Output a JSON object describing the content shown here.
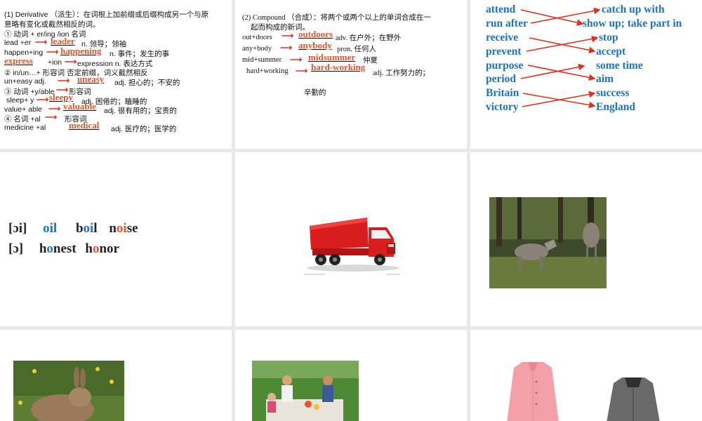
{
  "slide1": {
    "heading1": "(1) Derivative （派生）：在词根上加前缀或后缀构成另一个与原",
    "heading2": "意略有变化或截然相反的词。",
    "l1": "① 动词 + er/ing /ion      名词",
    "l2a": "lead +er",
    "ans_leader": "leader",
    "l2b": "n. 领导；领袖",
    "l3a": "happen+ing",
    "ans_happening": "happening",
    "l3b": "n. 事件；发生的事",
    "ans_express": "express",
    "l4b": "+ion",
    "l4c": "expression n. 表达方式",
    "l5": "② in/un…+ 形容词     否定前缀，词义截然相反",
    "l6a": "un+easy   adj.",
    "ans_uneasy": "uneasy",
    "l6b": "adj. 担心的；不安的",
    "l7": "③ 动词 +y/able",
    "l7b": "形容词",
    "l8a": "sleep+ y",
    "ans_sleepy": "sleepy",
    "l8b": "adj. 困倦的；瞌睡的",
    "l9a": "value+ able",
    "ans_valuable": "valuable",
    "l9b": "adj. 很有用的；宝贵的",
    "l10a": "④  名词 +al",
    "l10b": "形容词",
    "l11a": "medicine +al",
    "ans_medical": "medical",
    "l11b": "adj. 医疗的；医学的"
  },
  "slide2": {
    "heading1": "(2) Compound （合成）：将两个或两个以上的单词合成在一",
    "heading2": "起而构成的新词。",
    "r1a": "out+doors",
    "ans_outdoors": "outdoors",
    "r1b": "adv. 在户外；在野外",
    "r2a": "any+body",
    "ans_anybody": "anybody",
    "r2b": "pron. 任何人",
    "r3a": "mid+summer",
    "ans_midsummer": "midsummer",
    "r3b": "仲夏",
    "r4a": "hard+working",
    "ans_hardworking": "hard-working",
    "r4b": "adj. 工作努力的；",
    "r5": "辛勤的"
  },
  "slide3": {
    "left": [
      "attend",
      "run after",
      "receive",
      "prevent",
      "purpose",
      "period",
      "Britain",
      "victory"
    ],
    "right": [
      "catch up with",
      "show up; take part in",
      "stop",
      "accept",
      "some time",
      "aim",
      "success",
      "England"
    ]
  },
  "slide4": {
    "sym1": "[ɔi]",
    "w1a": "oi",
    "w1a_rest": "l",
    "w2a": "b",
    "w2b": "oi",
    "w2c": "l",
    "w3a": "n",
    "w3b": "oi",
    "w3c": "se",
    "sym2": "[ɔ]",
    "w4a": "h",
    "w4b": "o",
    "w4c": "nest",
    "w5a": "h",
    "w5b": "o",
    "w5c": "nor"
  },
  "colors": {
    "answer": "#e8542a",
    "arrow": "#e03020",
    "match_text": "#1b72c7"
  },
  "images": {
    "truck": "red-dump-truck-illustration",
    "wolves": "two-grey-wolves-photo",
    "rabbit": "wild-rabbit-in-grass-photo",
    "picnic": "family-picnic-photo",
    "coat_pink": "pink-coat-photo",
    "coat_grey": "grey-jacket-photo"
  }
}
